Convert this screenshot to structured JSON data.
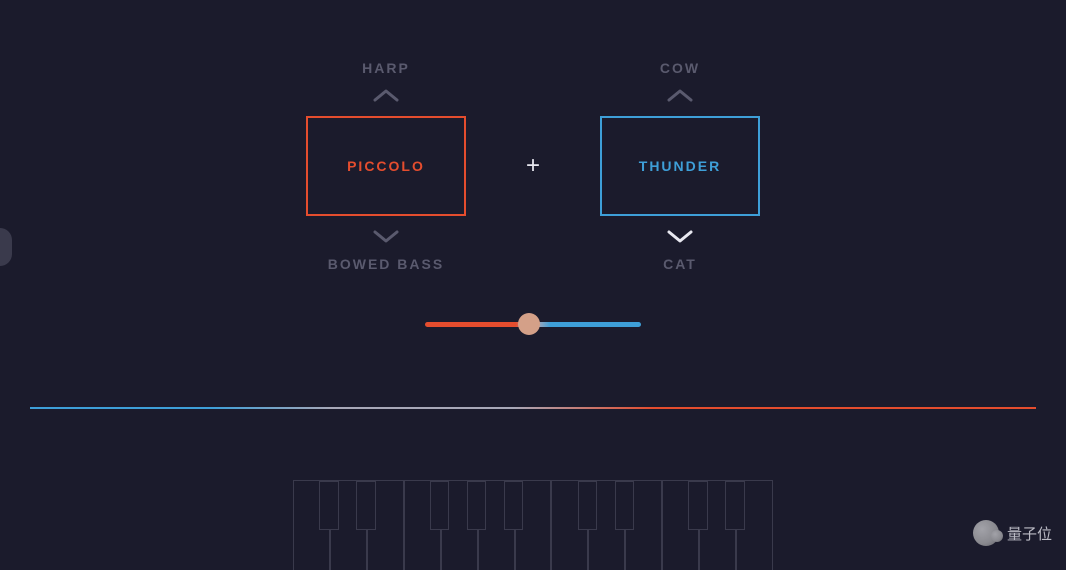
{
  "selectors": {
    "left": {
      "prev_option": "HARP",
      "current": "PICCOLO",
      "next_option": "BOWED BASS",
      "accent_color": "#e54d2e"
    },
    "right": {
      "prev_option": "COW",
      "current": "THUNDER",
      "next_option": "CAT",
      "accent_color": "#3e9fd8"
    },
    "combine_symbol": "+"
  },
  "blend_slider": {
    "value_percent": 48
  },
  "watermark": {
    "text": "量子位"
  }
}
